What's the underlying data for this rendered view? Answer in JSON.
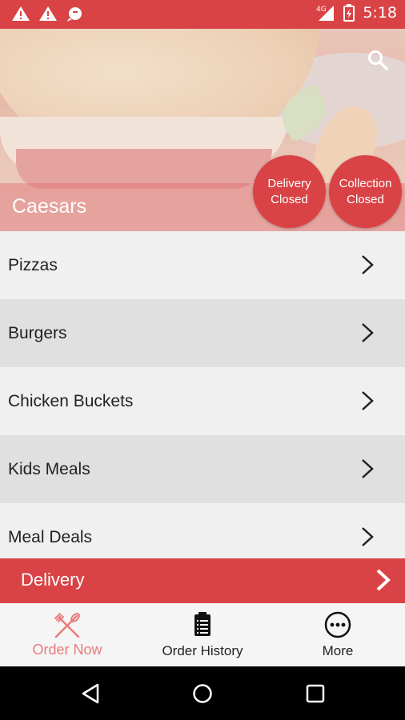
{
  "status_bar": {
    "time": "5:18",
    "network": "4G"
  },
  "header": {
    "restaurant_name": "Caesars",
    "search_icon": "search-icon"
  },
  "badges": {
    "delivery": [
      "Delivery",
      "Closed"
    ],
    "collection": [
      "Collection",
      "Closed"
    ]
  },
  "menu": {
    "items": [
      {
        "label": "Pizzas"
      },
      {
        "label": "Burgers"
      },
      {
        "label": "Chicken Buckets"
      },
      {
        "label": "Kids Meals"
      },
      {
        "label": "Meal Deals"
      }
    ]
  },
  "order_mode_bar": {
    "label": "Delivery"
  },
  "tabs": [
    {
      "label": "Order Now",
      "icon": "fork-knife-icon",
      "active": true
    },
    {
      "label": "Order History",
      "icon": "clipboard-icon",
      "active": false
    },
    {
      "label": "More",
      "icon": "more-icon",
      "active": false
    }
  ],
  "colors": {
    "brand": "#d94345",
    "active_tab": "#e97b7b"
  }
}
